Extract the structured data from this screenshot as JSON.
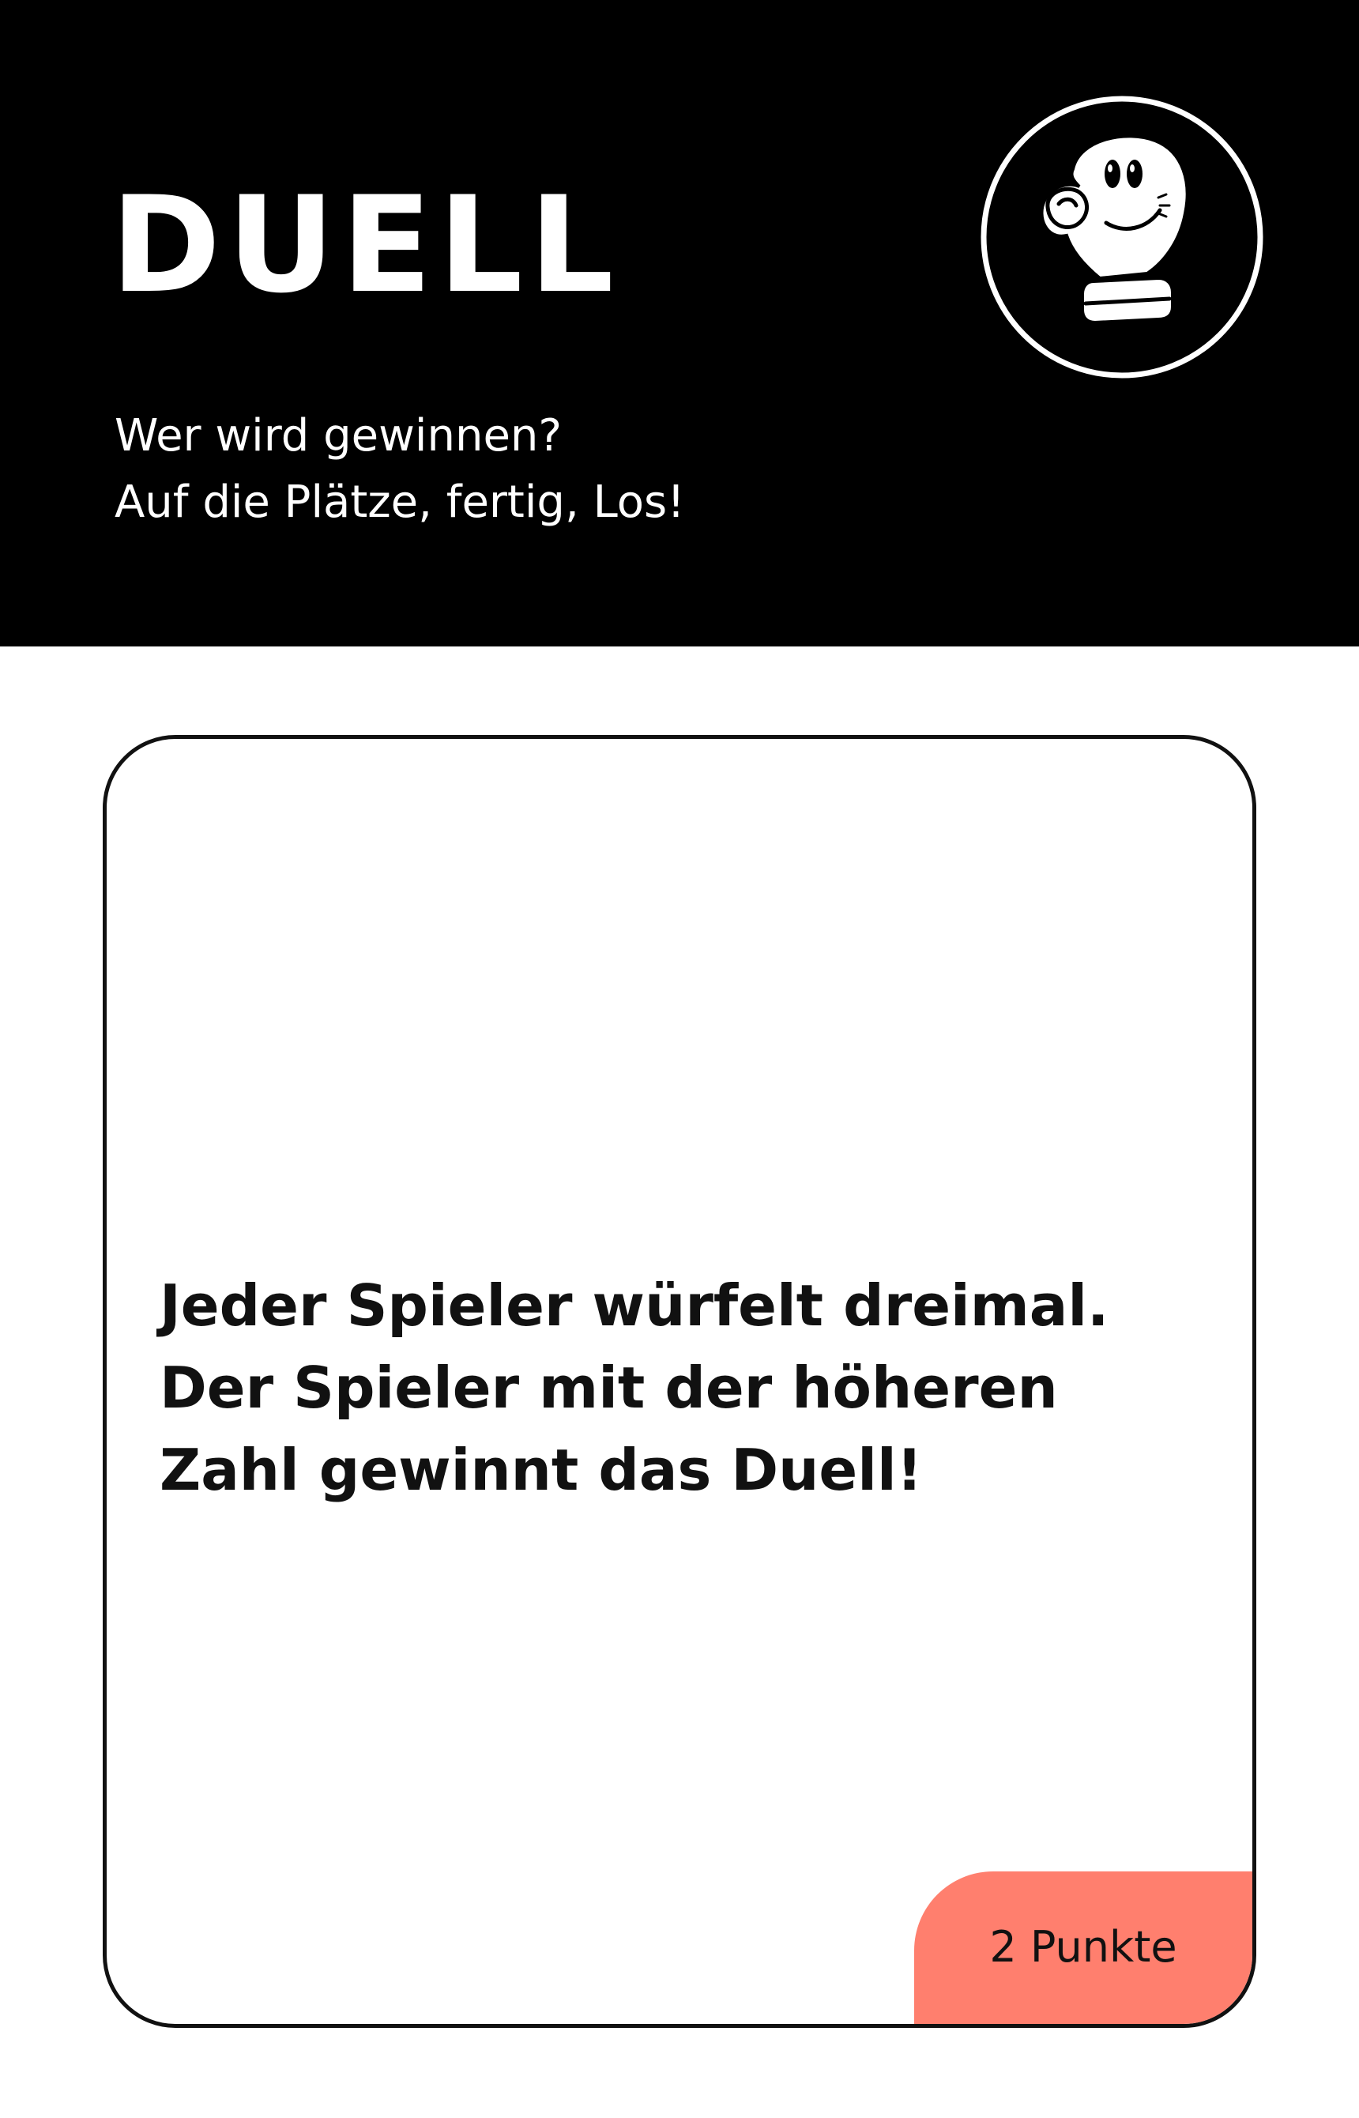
{
  "header": {
    "title": "DUELL",
    "subtitle_lines": [
      "Wer wird gewinnen?",
      "Auf die Plätze, fertig, Los!"
    ],
    "logo": "boxing-glove-icon"
  },
  "card": {
    "text_lines": [
      "Jeder Spieler würfelt dreimal.",
      "Der Spieler mit der höheren",
      "Zahl gewinnt das Duell!"
    ],
    "points_label": "2 Punkte"
  },
  "colors": {
    "header_background": "#000000",
    "header_text": "#ffffff",
    "card_border": "#111111",
    "points_badge": "#ff7f6e"
  }
}
